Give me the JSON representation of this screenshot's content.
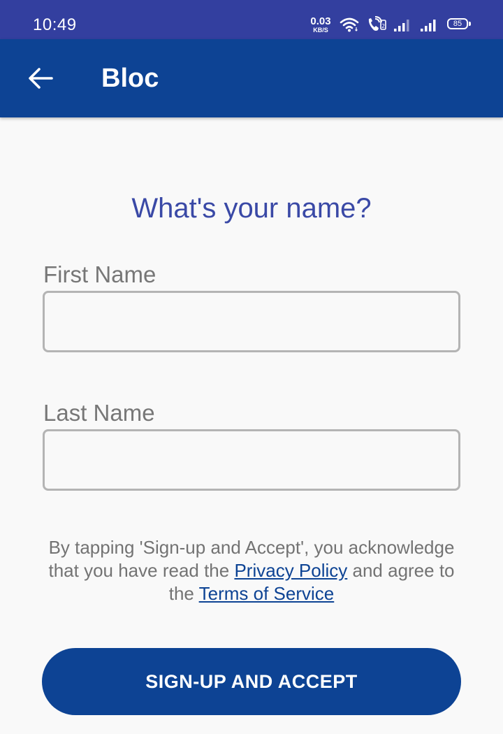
{
  "status_bar": {
    "time": "10:49",
    "net_speed_value": "0.03",
    "net_speed_unit": "KB/S",
    "battery": "85",
    "icons": [
      "wifi-icon",
      "volte-call-icon",
      "signal-icon",
      "signal-icon"
    ]
  },
  "app_bar": {
    "title": "Bloc",
    "back_icon": "arrow-left-icon"
  },
  "form": {
    "heading": "What's your name?",
    "first_name_label": "First Name",
    "first_name_value": "",
    "last_name_label": "Last Name",
    "last_name_value": ""
  },
  "legal": {
    "text_1": "By tapping 'Sign-up and Accept', you acknowledge that you have read the ",
    "privacy_link": "Privacy Policy",
    "text_2": " and agree to the ",
    "terms_link": "Terms of Service"
  },
  "submit": {
    "label": "SIGN-UP AND ACCEPT"
  },
  "colors": {
    "status_bar": "#333f9f",
    "app_bar": "#0d4394",
    "heading": "#3a49a6",
    "background": "#f9f9f9",
    "label": "#777777",
    "field_border": "#b4b4b4"
  }
}
